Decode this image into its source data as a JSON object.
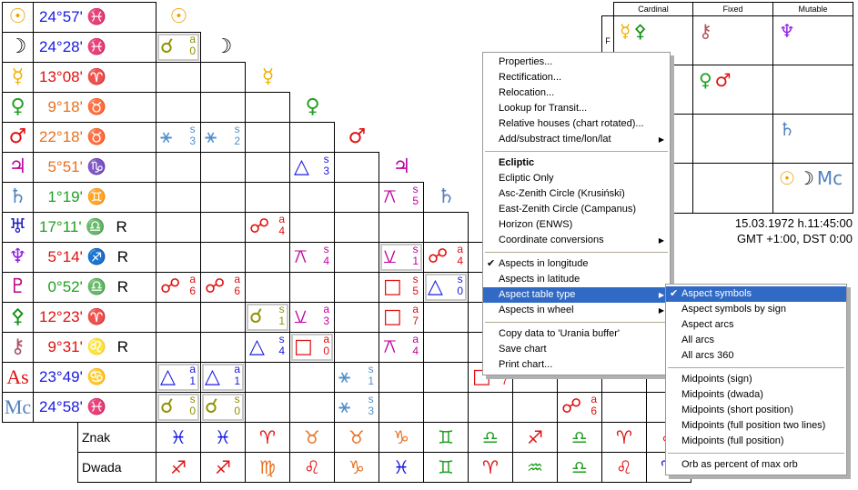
{
  "planets": [
    {
      "name": "sun",
      "glyph": "☉",
      "color": "#f0a000",
      "pos": "24°57'",
      "sign": "♓",
      "signColor": "#1a1ae0",
      "r": ""
    },
    {
      "name": "moon",
      "glyph": "☽",
      "color": "#000000",
      "pos": "24°28'",
      "sign": "♓",
      "signColor": "#1a1ae0",
      "r": ""
    },
    {
      "name": "mercury",
      "glyph": "☿",
      "color": "#f0b000",
      "pos": "13°08'",
      "sign": "♈",
      "signColor": "#e01010",
      "r": ""
    },
    {
      "name": "venus",
      "glyph": "♀",
      "color": "#20a020",
      "pos": "  9°18'",
      "sign": "♉",
      "signColor": "#e87020",
      "r": ""
    },
    {
      "name": "mars",
      "glyph": "♂",
      "color": "#e01010",
      "pos": "22°18'",
      "sign": "♉",
      "signColor": "#e87020",
      "r": ""
    },
    {
      "name": "jupiter",
      "glyph": "♃",
      "color": "#c000a0",
      "pos": "  5°51'",
      "sign": "♑",
      "signColor": "#e87020",
      "r": ""
    },
    {
      "name": "saturn",
      "glyph": "♄",
      "color": "#5080c0",
      "pos": "  1°19'",
      "sign": "♊",
      "signColor": "#20a020",
      "r": ""
    },
    {
      "name": "uranus",
      "glyph": "♅",
      "color": "#2020c0",
      "pos": "17°11'",
      "sign": "♎",
      "signColor": "#20a020",
      "r": "R"
    },
    {
      "name": "neptune",
      "glyph": "♆",
      "color": "#9020e0",
      "pos": "  5°14'",
      "sign": "♐",
      "signColor": "#e01010",
      "r": "R"
    },
    {
      "name": "pluto",
      "glyph": "♇",
      "color": "#c00080",
      "pos": "  0°52'",
      "sign": "♎",
      "signColor": "#20a020",
      "r": "R"
    },
    {
      "name": "green-body",
      "glyph": "⚴",
      "color": "#109010",
      "pos": "12°23'",
      "sign": "♈",
      "signColor": "#e01010",
      "r": ""
    },
    {
      "name": "chiron",
      "glyph": "⚷",
      "color": "#b05060",
      "pos": "  9°31'",
      "sign": "♌",
      "signColor": "#e01010",
      "r": "R"
    },
    {
      "name": "ascendant",
      "glyph": "As",
      "color": "#e01010",
      "pos": "23°49'",
      "sign": "♋",
      "signColor": "#1a1ae0",
      "r": ""
    },
    {
      "name": "midheaven",
      "glyph": "Mc",
      "color": "#5080c0",
      "pos": "24°58'",
      "sign": "♓",
      "signColor": "#1a1ae0",
      "r": ""
    }
  ],
  "aspects": [
    {
      "row": 1,
      "col": 0,
      "glyph": "☌",
      "t": "a",
      "n": "0",
      "color": "#909000",
      "box": true
    },
    {
      "row": 4,
      "col": 0,
      "glyph": "⚹",
      "t": "s",
      "n": "3",
      "color": "#5090c8",
      "box": false
    },
    {
      "row": 4,
      "col": 1,
      "glyph": "⚹",
      "t": "s",
      "n": "2",
      "color": "#5090c8",
      "box": false
    },
    {
      "row": 5,
      "col": 3,
      "glyph": "△",
      "t": "s",
      "n": "3",
      "color": "#1a1ae0",
      "box": false
    },
    {
      "row": 6,
      "col": 5,
      "glyph": "⚻",
      "t": "s",
      "n": "5",
      "color": "#c000a0",
      "box": false
    },
    {
      "row": 7,
      "col": 2,
      "glyph": "☍",
      "t": "a",
      "n": "4",
      "color": "#e01010",
      "box": false
    },
    {
      "row": 8,
      "col": 3,
      "glyph": "⚻",
      "t": "s",
      "n": "4",
      "color": "#c000a0",
      "box": false
    },
    {
      "row": 8,
      "col": 5,
      "glyph": "⚺",
      "t": "s",
      "n": "1",
      "color": "#c000a0",
      "box": true
    },
    {
      "row": 8,
      "col": 6,
      "glyph": "☍",
      "t": "a",
      "n": "4",
      "color": "#e01010",
      "box": false
    },
    {
      "row": 9,
      "col": 0,
      "glyph": "☍",
      "t": "a",
      "n": "6",
      "color": "#e01010",
      "box": false
    },
    {
      "row": 9,
      "col": 1,
      "glyph": "☍",
      "t": "a",
      "n": "6",
      "color": "#e01010",
      "box": false
    },
    {
      "row": 9,
      "col": 5,
      "glyph": "□",
      "t": "s",
      "n": "5",
      "color": "#e01010",
      "box": false
    },
    {
      "row": 9,
      "col": 6,
      "glyph": "△",
      "t": "s",
      "n": "0",
      "color": "#1a1ae0",
      "box": true
    },
    {
      "row": 10,
      "col": 2,
      "glyph": "☌",
      "t": "s",
      "n": "1",
      "color": "#909000",
      "box": true
    },
    {
      "row": 10,
      "col": 3,
      "glyph": "⚺",
      "t": "a",
      "n": "3",
      "color": "#c000a0",
      "box": false
    },
    {
      "row": 10,
      "col": 5,
      "glyph": "□",
      "t": "a",
      "n": "7",
      "color": "#e01010",
      "box": false
    },
    {
      "row": 11,
      "col": 2,
      "glyph": "△",
      "t": "s",
      "n": "4",
      "color": "#1a1ae0",
      "box": false
    },
    {
      "row": 11,
      "col": 3,
      "glyph": "□",
      "t": "a",
      "n": "0",
      "color": "#e01010",
      "box": true
    },
    {
      "row": 11,
      "col": 5,
      "glyph": "⚻",
      "t": "a",
      "n": "4",
      "color": "#c000a0",
      "box": false
    },
    {
      "row": 12,
      "col": 0,
      "glyph": "△",
      "t": "a",
      "n": "1",
      "color": "#1a1ae0",
      "box": true
    },
    {
      "row": 12,
      "col": 1,
      "glyph": "△",
      "t": "a",
      "n": "1",
      "color": "#1a1ae0",
      "box": true
    },
    {
      "row": 12,
      "col": 4,
      "glyph": "⚹",
      "t": "s",
      "n": "1",
      "color": "#5090c8",
      "box": false
    },
    {
      "row": 12,
      "col": 7,
      "glyph": "□",
      "t": "",
      "n": "7",
      "color": "#e01010",
      "box": false
    },
    {
      "row": 13,
      "col": 0,
      "glyph": "☌",
      "t": "s",
      "n": "0",
      "color": "#909000",
      "box": true
    },
    {
      "row": 13,
      "col": 1,
      "glyph": "☌",
      "t": "s",
      "n": "0",
      "color": "#909000",
      "box": true
    },
    {
      "row": 13,
      "col": 4,
      "glyph": "⚹",
      "t": "s",
      "n": "3",
      "color": "#5090c8",
      "box": false
    },
    {
      "row": 13,
      "col": 9,
      "glyph": "☍",
      "t": "a",
      "n": "6",
      "color": "#e01010",
      "box": false
    }
  ],
  "znak": {
    "label": "Znak",
    "signs": [
      [
        "♓",
        "#1a1ae0"
      ],
      [
        "♓",
        "#1a1ae0"
      ],
      [
        "♈",
        "#e01010"
      ],
      [
        "♉",
        "#e87020"
      ],
      [
        "♉",
        "#e87020"
      ],
      [
        "♑",
        "#e87020"
      ],
      [
        "♊",
        "#20a020"
      ],
      [
        "♎",
        "#20a020"
      ],
      [
        "♐",
        "#e01010"
      ],
      [
        "♎",
        "#20a020"
      ],
      [
        "♈",
        "#e01010"
      ],
      [
        "♌",
        "#e01010"
      ]
    ]
  },
  "dwada": {
    "label": "Dwada",
    "signs": [
      [
        "♐",
        "#e01010"
      ],
      [
        "♐",
        "#e01010"
      ],
      [
        "♍",
        "#e87020"
      ],
      [
        "♌",
        "#e01010"
      ],
      [
        "♑",
        "#e87020"
      ],
      [
        "♓",
        "#1a1ae0"
      ],
      [
        "♊",
        "#20a020"
      ],
      [
        "♈",
        "#e01010"
      ],
      [
        "♒",
        "#20a020"
      ],
      [
        "♎",
        "#20a020"
      ],
      [
        "♌",
        "#e01010"
      ],
      [
        "♈",
        "#1a1ae0"
      ]
    ]
  },
  "elements": {
    "headers": [
      "Cardinal",
      "Fixed",
      "Mutable"
    ],
    "rowLabels": [
      "F",
      "",
      "",
      ""
    ],
    "cells": [
      [
        [
          [
            "☿",
            "#f0b000"
          ],
          [
            "⚴",
            "#109010"
          ]
        ],
        [
          [
            "⚷",
            "#b05060"
          ]
        ],
        [
          [
            "♆",
            "#9020e0"
          ]
        ]
      ],
      [
        [],
        [
          [
            "♀",
            "#20a020"
          ],
          [
            "♂",
            "#e01010"
          ]
        ],
        []
      ],
      [
        [],
        [],
        [
          [
            "♄",
            "#5080c0"
          ]
        ]
      ],
      [
        [],
        [],
        [
          [
            "☉",
            "#f0a000"
          ],
          [
            "☽",
            "#000000"
          ],
          [
            "Mc",
            "#5080c0"
          ]
        ]
      ]
    ]
  },
  "info": {
    "date": "15.03.1972 h.11:45:00",
    "tz": "GMT +1:00, DST 0:00"
  },
  "menu": [
    {
      "label": "Properties..."
    },
    {
      "label": "Rectification..."
    },
    {
      "label": "Relocation..."
    },
    {
      "label": "Lookup for Transit..."
    },
    {
      "label": "Relative houses (chart rotated)..."
    },
    {
      "label": "Add/substract time/lon/lat",
      "sub": true
    },
    {
      "sep": true
    },
    {
      "label": "Ecliptic",
      "bold": true
    },
    {
      "label": "Ecliptic Only"
    },
    {
      "label": "Asc-Zenith Circle (Krusiński)"
    },
    {
      "label": "East-Zenith Circle (Campanus)"
    },
    {
      "label": "Horizon (ENWS)"
    },
    {
      "label": "Coordinate conversions",
      "sub": true
    },
    {
      "sep": true
    },
    {
      "label": "Aspects in longitude",
      "checked": true
    },
    {
      "label": "Aspects in latitude"
    },
    {
      "label": "Aspect table type",
      "sub": true,
      "hl": true
    },
    {
      "label": "Aspects in wheel",
      "sub": true
    },
    {
      "sep": true
    },
    {
      "label": "Copy data to 'Urania buffer'"
    },
    {
      "label": "Save chart"
    },
    {
      "label": "Print chart..."
    }
  ],
  "submenu": [
    {
      "label": "Aspect symbols",
      "checked": true,
      "hl": true
    },
    {
      "label": "Aspect symbols by sign"
    },
    {
      "label": "Aspect arcs"
    },
    {
      "label": "All arcs"
    },
    {
      "label": "All arcs 360"
    },
    {
      "sep": true
    },
    {
      "label": "Midpoints (sign)"
    },
    {
      "label": "Midpoints (dwada)"
    },
    {
      "label": "Midpoints (short position)"
    },
    {
      "label": "Midpoints (full position two lines)"
    },
    {
      "label": "Midpoints (full position)"
    },
    {
      "sep": true
    },
    {
      "label": "Orb as percent of max orb"
    }
  ]
}
